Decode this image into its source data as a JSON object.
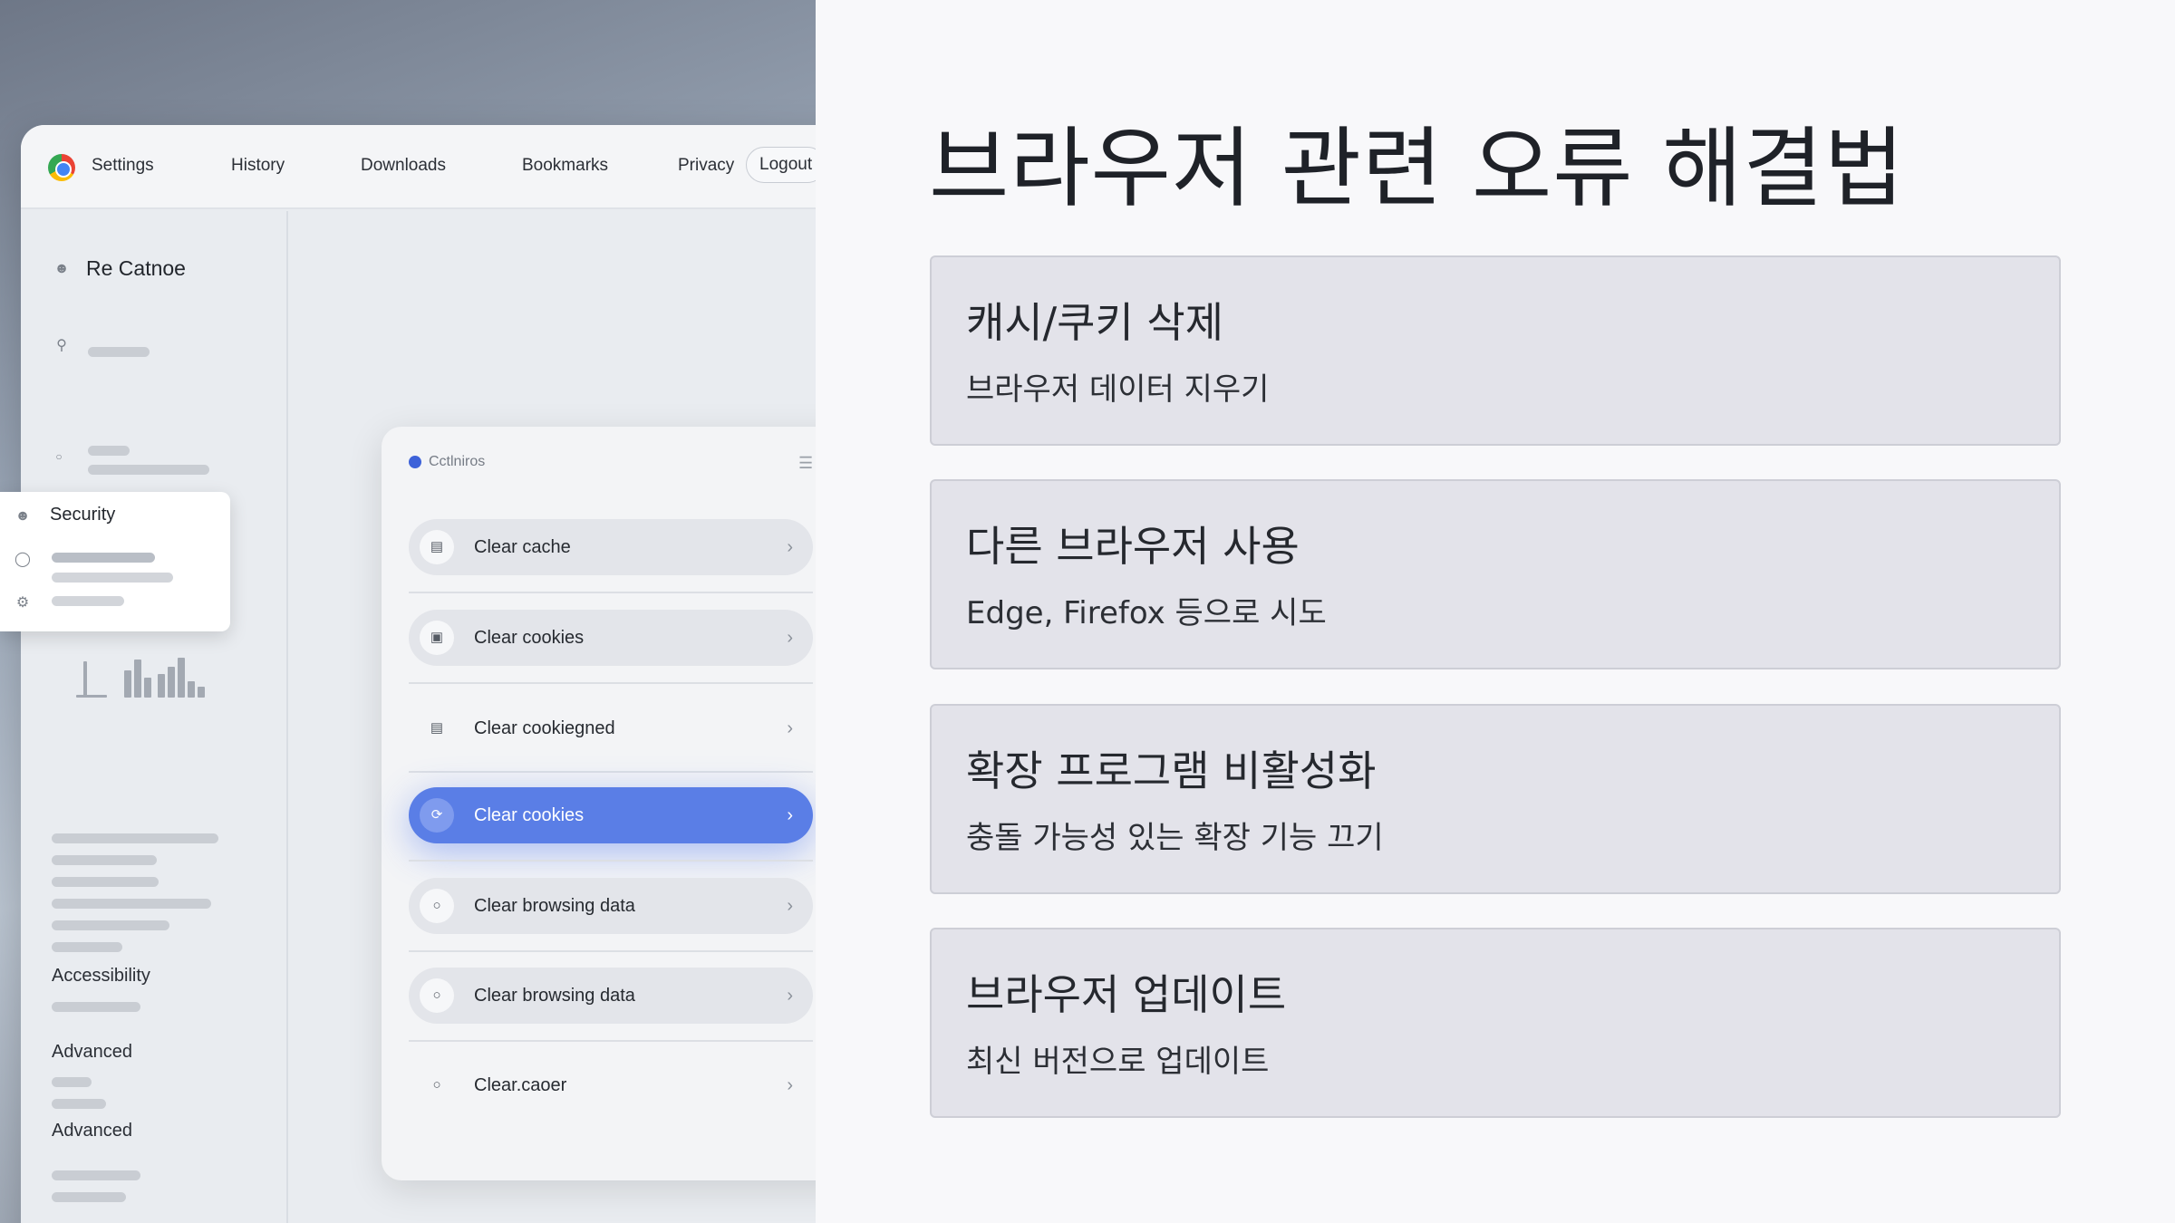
{
  "nav": {
    "items": [
      "Settings",
      "History",
      "Downloads",
      "Bookmarks",
      "Privacy"
    ],
    "logout": "Logout"
  },
  "sidebar": {
    "profile_name": "Re  Catnoe",
    "security_label": "Security",
    "accessibility_label": "Accessibility",
    "advanced_label_1": "Advanced",
    "advanced_label_2": "Advanced"
  },
  "dialog": {
    "title": "Cctlniros",
    "options": [
      {
        "label": "Clear cache",
        "icon": "storage-icon"
      },
      {
        "label": "Clear cookies",
        "icon": "cookie-icon"
      },
      {
        "label": "Clear cookiegned",
        "icon": "database-icon"
      },
      {
        "label": "Clear cookies",
        "icon": "refresh-icon"
      },
      {
        "label": "Clear browsing data",
        "icon": "circle-icon"
      },
      {
        "label": "Clear browsing data",
        "icon": "circle-icon"
      },
      {
        "label": "Clear.caoer",
        "icon": "circle-icon"
      }
    ],
    "active_index": 3,
    "accent_color": "#5a7ee6"
  },
  "main": {
    "title": "브라우저 관련 오류 해결법",
    "cards": [
      {
        "title": "캐시/쿠키 삭제",
        "desc": "브라우저 데이터 지우기"
      },
      {
        "title": "다른 브라우저 사용",
        "desc": "Edge, Firefox 등으로 시도"
      },
      {
        "title": "확장 프로그램 비활성화",
        "desc": "충돌 가능성 있는 확장 기능 끄기"
      },
      {
        "title": "브라우저 업데이트",
        "desc": "최신 버전으로 업데이트"
      }
    ]
  }
}
